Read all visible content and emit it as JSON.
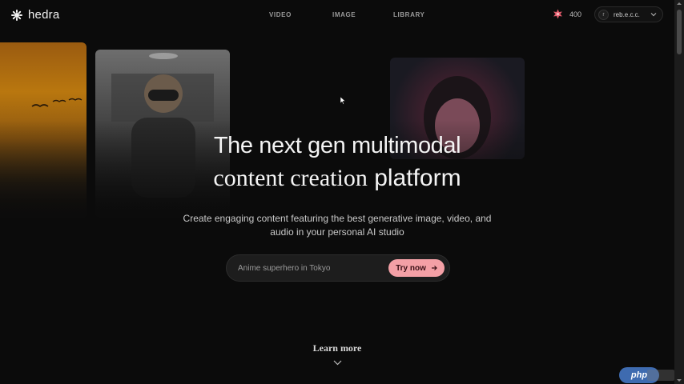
{
  "header": {
    "logo_text": "hedra",
    "nav": [
      {
        "label": "VIDEO"
      },
      {
        "label": "IMAGE"
      },
      {
        "label": "LIBRARY"
      }
    ],
    "credits": "400",
    "user": {
      "avatar_initial": "r",
      "name": "reb.e.c.c."
    }
  },
  "hero": {
    "title_line1": "The next gen multimodal",
    "title_line2_serif": "content creation",
    "title_line2_sans": "platform",
    "subtitle": "Create engaging content featuring the best generative image, video, and audio in your personal AI studio"
  },
  "prompt": {
    "placeholder": "Anime superhero in Tokyo",
    "button_label": "Try now"
  },
  "learn_more": "Learn more",
  "watermark": "php",
  "colors": {
    "accent": "#f4a0a6",
    "credits_icon": "#e05a6a",
    "background": "#0b0b0b"
  },
  "icons": [
    "logo-icon",
    "credits-icon",
    "chevron-down-icon",
    "arrow-right-icon",
    "learn-more-chevron-icon"
  ]
}
